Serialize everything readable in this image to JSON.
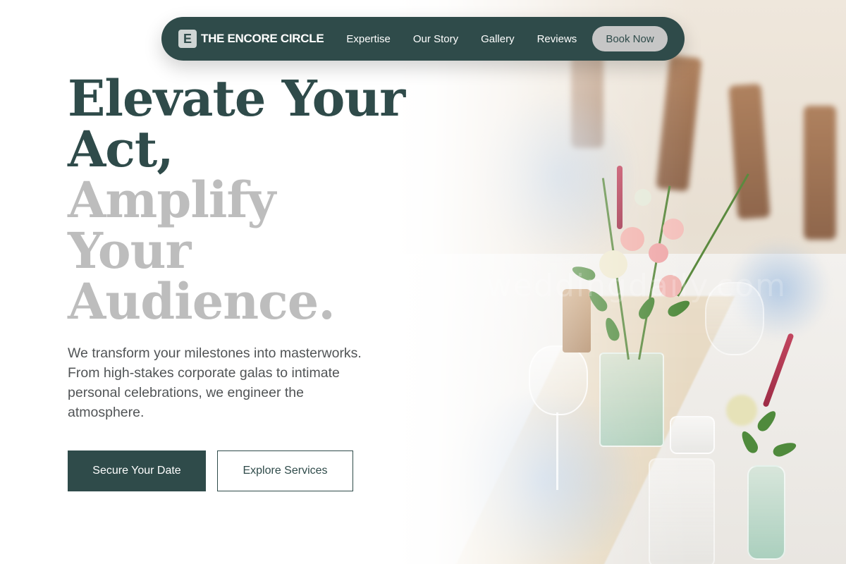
{
  "nav": {
    "logo_letter": "E",
    "brand": "THE ENCORE CIRCLE",
    "links": [
      {
        "label": "Expertise"
      },
      {
        "label": "Our Story"
      },
      {
        "label": "Gallery"
      },
      {
        "label": "Reviews"
      }
    ],
    "cta": "Book Now"
  },
  "hero": {
    "headline_lines": [
      {
        "text": "Elevate Your",
        "tone": "dark"
      },
      {
        "text": "Act,",
        "tone": "dark"
      },
      {
        "text": "Amplify",
        "tone": "light"
      },
      {
        "text": "Your",
        "tone": "light"
      },
      {
        "text": "Audience.",
        "tone": "light"
      }
    ],
    "subcopy": "We transform your milestones into masterworks. From high-stakes corporate galas to intimate personal celebrations, we engineer the atmosphere.",
    "primary_cta": "Secure Your Date",
    "secondary_cta": "Explore Services",
    "image_watermark": "weddingdaily.com"
  },
  "colors": {
    "brand": "#2f4b4a",
    "muted_heading": "#bdbdbd",
    "nav_button_bg": "#c6c6c6"
  }
}
